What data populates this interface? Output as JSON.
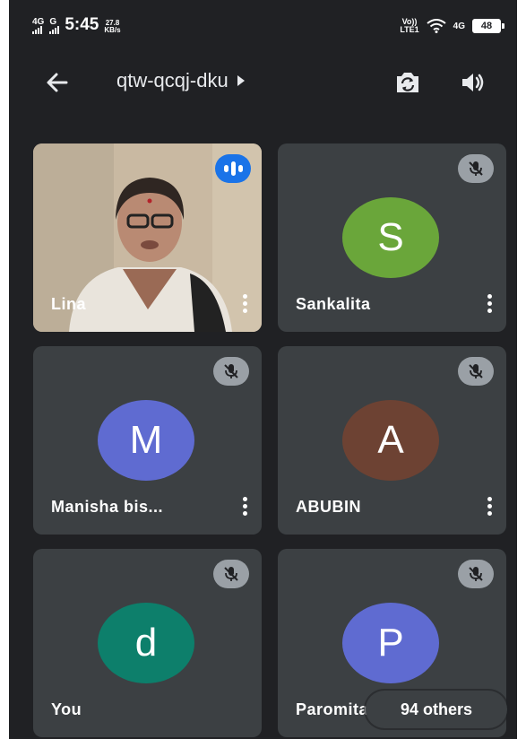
{
  "status_bar": {
    "network_1": "4G",
    "network_2": "G",
    "time": "5:45",
    "speed_value": "27.8",
    "speed_unit": "KB/s",
    "volte_line1": "Vo))",
    "volte_line2": "LTE1",
    "network_right": "4G",
    "battery": "48"
  },
  "top_bar": {
    "meeting_code": "qtw-qcqj-dku"
  },
  "participants": [
    {
      "name": "Lina",
      "initial": "",
      "avatar_color": "",
      "speaking": true,
      "muted": false,
      "video": true
    },
    {
      "name": "Sankalita",
      "initial": "S",
      "avatar_color": "#6aa63a",
      "speaking": false,
      "muted": true,
      "video": false
    },
    {
      "name": "Manisha bis...",
      "initial": "M",
      "avatar_color": "#5f6bd1",
      "speaking": false,
      "muted": true,
      "video": false
    },
    {
      "name": "ABUBIN",
      "initial": "A",
      "avatar_color": "#6d4233",
      "speaking": false,
      "muted": true,
      "video": false
    },
    {
      "name": "You",
      "initial": "d",
      "avatar_color": "#0d7f6b",
      "speaking": false,
      "muted": true,
      "video": false
    },
    {
      "name": "Paromita",
      "initial": "P",
      "avatar_color": "#5f6bd1",
      "speaking": false,
      "muted": true,
      "video": false
    }
  ],
  "others_pill": "94 others",
  "colors": {
    "background": "#202124",
    "tile": "#3c4043",
    "speaking_badge": "#1a73e8",
    "mute_badge": "#9aa0a6"
  }
}
